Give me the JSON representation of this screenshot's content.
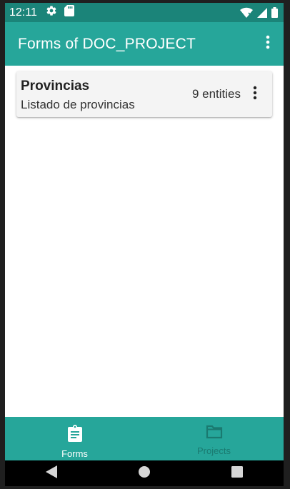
{
  "status_bar": {
    "time": "12:11",
    "icons_left": [
      "settings-icon",
      "sd-card-icon"
    ],
    "icons_right": [
      "wifi-icon",
      "signal-icon",
      "battery-icon"
    ]
  },
  "app_bar": {
    "title": "Forms of DOC_PROJECT",
    "overflow_icon": "more-vert-icon"
  },
  "forms": [
    {
      "title": "Provincias",
      "subtitle": "Listado de provincias",
      "count": "9 entities",
      "menu_icon": "more-vert-icon"
    }
  ],
  "bottom_nav": {
    "items": [
      {
        "label": "Forms",
        "icon": "clipboard-icon",
        "active": true
      },
      {
        "label": "Projects",
        "icon": "folder-icon",
        "active": false
      }
    ]
  },
  "system_nav": [
    "back-icon",
    "home-icon",
    "recents-icon"
  ],
  "colors": {
    "status_bar": "#1b8479",
    "primary": "#26a69a",
    "inactive_nav": "#1a7a70",
    "card_bg": "#f4f4f4"
  }
}
